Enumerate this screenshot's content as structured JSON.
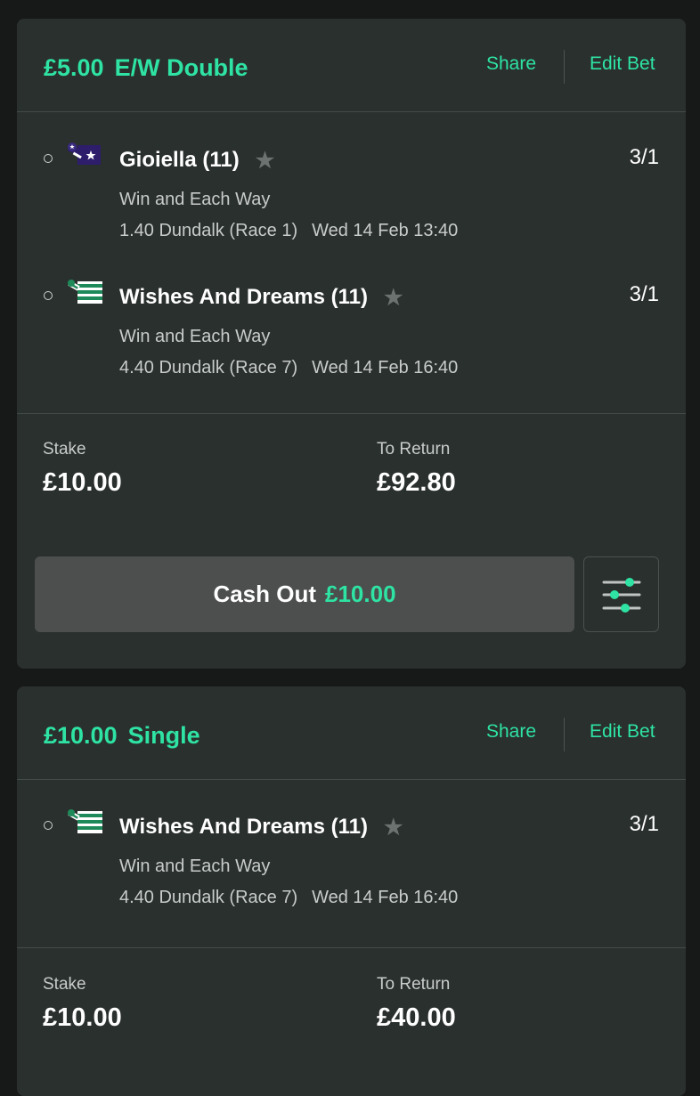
{
  "bets": [
    {
      "stake_amount": "£5.00",
      "bet_type": "E/W Double",
      "share_label": "Share",
      "edit_label": "Edit Bet",
      "selections": [
        {
          "horse": "Gioiella (11)",
          "odds": "3/1",
          "market": "Win and Each Way",
          "event": "1.40 Dundalk (Race 1)",
          "event_time": "Wed 14 Feb 13:40",
          "silk_icon": "purple-silk-with-star"
        },
        {
          "horse": "Wishes And Dreams (11)",
          "odds": "3/1",
          "market": "Win and Each Way",
          "event": "4.40 Dundalk (Race 7)",
          "event_time": "Wed 14 Feb 16:40",
          "silk_icon": "green-white-hooped-silk"
        }
      ],
      "stake_label": "Stake",
      "stake_value": "£10.00",
      "return_label": "To Return",
      "return_value": "£92.80",
      "cashout_label": "Cash Out",
      "cashout_amount": "£10.00"
    },
    {
      "stake_amount": "£10.00",
      "bet_type": "Single",
      "share_label": "Share",
      "edit_label": "Edit Bet",
      "selections": [
        {
          "horse": "Wishes And Dreams (11)",
          "odds": "3/1",
          "market": "Win and Each Way",
          "event": "4.40 Dundalk (Race 7)",
          "event_time": "Wed 14 Feb 16:40",
          "silk_icon": "green-white-hooped-silk"
        }
      ],
      "stake_label": "Stake",
      "stake_value": "£10.00",
      "return_label": "To Return",
      "return_value": "£40.00"
    }
  ],
  "colors": {
    "accent": "#2ee3a3",
    "card_bg": "#2a302e",
    "page_bg": "#171918",
    "button_bg": "#4c4f4e"
  }
}
